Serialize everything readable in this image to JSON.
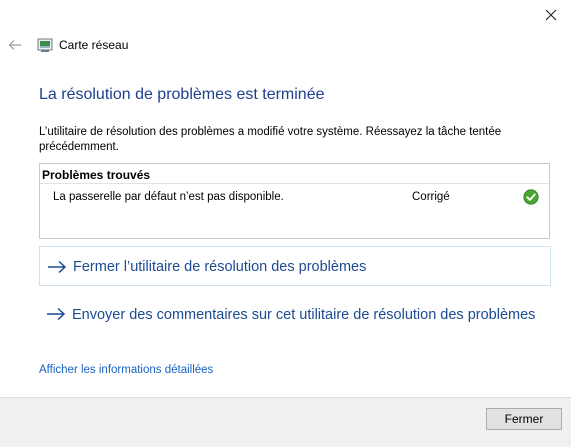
{
  "window": {
    "title": "Carte réseau",
    "close_icon": "close-icon",
    "back_icon": "back-arrow-icon",
    "app_icon": "network-adapter-icon"
  },
  "main": {
    "heading": "La résolution de problèmes est terminée",
    "description": "L’utilitaire de résolution des problèmes a modifié votre système. Réessayez la tâche tentée précédemment."
  },
  "problems": {
    "header": "Problèmes trouvés",
    "items": [
      {
        "description": "La passerelle par défaut n’est pas disponible.",
        "status": "Corrigé",
        "status_icon": "check-icon"
      }
    ]
  },
  "actions": {
    "close_troubleshooter": "Fermer l’utilitaire de résolution des problèmes",
    "send_feedback": "Envoyer des commentaires sur cet utilitaire de résolution des problèmes",
    "arrow_icon": "arrow-right-icon",
    "details_link": "Afficher les informations détaillées"
  },
  "footer": {
    "close_button": "Fermer"
  },
  "colors": {
    "heading": "#1e3f8f",
    "link": "#1c4a93",
    "details_link": "#1a61c3",
    "check_green": "#4aa832",
    "footer_bg": "#f0f0f0"
  }
}
